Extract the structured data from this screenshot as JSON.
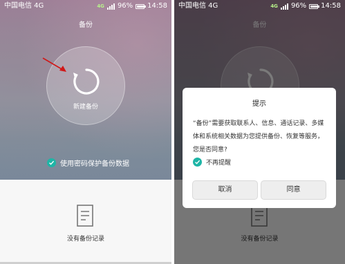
{
  "colors": {
    "accent": "#1eb5a6",
    "net_badge": "#b7f28a"
  },
  "status_bar": {
    "carrier": "中国电信 4G",
    "network_badge": "4G",
    "battery_percent": "96%",
    "time": "14:58",
    "battery_level": 0.96
  },
  "screen": {
    "title": "备份",
    "backup_button_label": "新建备份",
    "password_option_label": "使用密码保护备份数据",
    "password_option_checked": true,
    "empty_state_label": "没有备份记录",
    "icons": [
      "refresh-icon",
      "arrow-icon",
      "check-icon",
      "document-icon"
    ]
  },
  "dialog": {
    "title": "提示",
    "message": "“备份”需要获取联系人、信息、通话记录、多媒体和系统相关数据为您提供备份、恢复等服务，您是否同意?",
    "dont_remind_label": "不再提醒",
    "dont_remind_checked": true,
    "cancel_label": "取消",
    "agree_label": "同意"
  }
}
